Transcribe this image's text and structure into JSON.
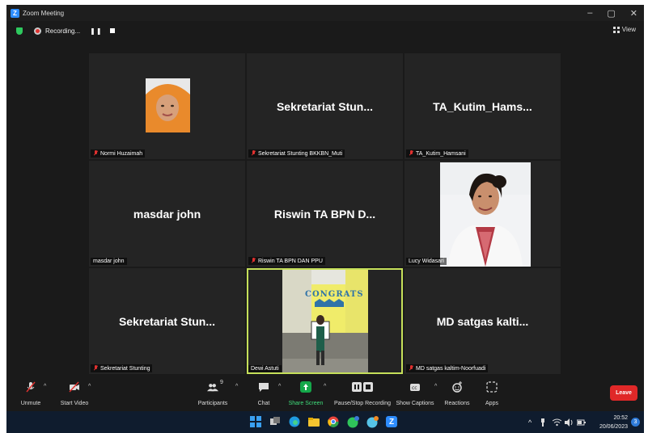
{
  "window": {
    "title": "Zoom Meeting",
    "logo_letter": "Z",
    "controls": {
      "minimize": "–",
      "maximize": "▢",
      "close": "✕"
    }
  },
  "recording": {
    "label": "Recording...",
    "pause_symbol": "❚❚"
  },
  "view_button": {
    "label": "View"
  },
  "participants": [
    {
      "name": "Normi Huzaimah",
      "display_name": "",
      "muted": true,
      "video": "photo"
    },
    {
      "name": "Sekretariat Stunting BKKBN_Muti",
      "display_name": "Sekretariat Stun...",
      "muted": true,
      "video": "off"
    },
    {
      "name": "TA_Kutim_Hamsani",
      "display_name": "TA_Kutim_Hams...",
      "muted": true,
      "video": "off"
    },
    {
      "name": "masdar john",
      "display_name": "masdar john",
      "muted": false,
      "video": "off"
    },
    {
      "name": "Riswin TA BPN DAN PPU",
      "display_name": "Riswin TA BPN D...",
      "muted": true,
      "video": "off"
    },
    {
      "name": "Lucy Widasari",
      "display_name": "",
      "muted": false,
      "video": "photo"
    },
    {
      "name": "Sekretariat Stunting",
      "display_name": "Sekretariat Stun...",
      "muted": true,
      "video": "off"
    },
    {
      "name": "Dewi Astuti",
      "display_name": "",
      "muted": false,
      "video": "camera",
      "active_speaker": true
    },
    {
      "name": "MD satgas kaltim-Noorfuadi",
      "display_name": "MD satgas kalti...",
      "muted": true,
      "video": "off"
    }
  ],
  "congrats_text": "CONGRATS",
  "toolbar": {
    "unmute": "Unmute",
    "start_video": "Start Video",
    "participants": "Participants",
    "participants_count": "9",
    "chat": "Chat",
    "share_screen": "Share Screen",
    "pause_stop_recording": "Pause/Stop Recording",
    "show_captions": "Show Captions",
    "reactions": "Reactions",
    "apps": "Apps",
    "leave": "Leave"
  },
  "taskbar": {
    "time": "20:52",
    "date": "20/06/2023",
    "notification_count": "3",
    "tray_caret": "^"
  },
  "colors": {
    "accent_green": "#2ec95e",
    "leave_red": "#e02828",
    "active_border": "#c6e05a",
    "share_green": "#14a84a"
  }
}
